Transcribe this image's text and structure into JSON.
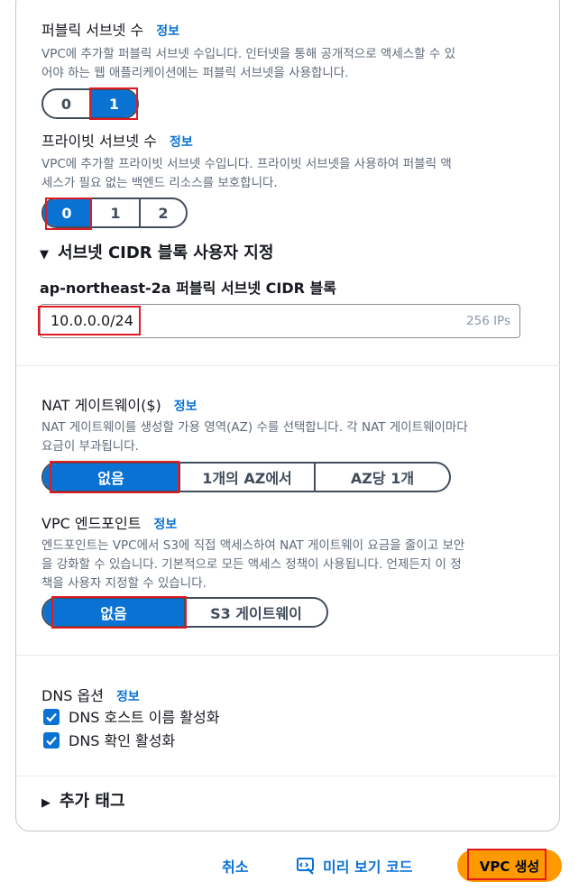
{
  "public_subnets": {
    "label": "퍼블릭 서브넷 수",
    "info": "정보",
    "desc_line1": "VPC에 추가할 퍼블릭 서브넷 수입니다. 인터넷을 통해 공개적으로 액세스할 수 있",
    "desc_line2": "어야 하는 웹 애플리케이션에는 퍼블릭 서브넷을 사용합니다.",
    "options": [
      "0",
      "1"
    ],
    "selected": "1"
  },
  "private_subnets": {
    "label": "프라이빗 서브넷 수",
    "info": "정보",
    "desc_line1": "VPC에 추가할 프라이빗 서브넷 수입니다. 프라이빗 서브넷을 사용하여 퍼블릭 액",
    "desc_line2": "세스가 필요 없는 백엔드 리소스를 보호합니다.",
    "options": [
      "0",
      "1",
      "2"
    ],
    "selected": "0"
  },
  "cidr_section": {
    "toggle_label": "서브넷 CIDR 블록 사용자 지정",
    "field_label": "ap-northeast-2a 퍼블릭 서브넷 CIDR 블록",
    "value": "10.0.0.0/24",
    "suffix": "256 IPs"
  },
  "nat": {
    "label": "NAT 게이트웨이($)",
    "info": "정보",
    "desc_line1": "NAT 게이트웨이를 생성할 가용 영역(AZ) 수를 선택합니다. 각 NAT 게이트웨이마다",
    "desc_line2": "요금이 부과됩니다.",
    "options": [
      "없음",
      "1개의 AZ에서",
      "AZ당 1개"
    ],
    "selected": "없음"
  },
  "endpoint": {
    "label": "VPC 엔드포인트",
    "info": "정보",
    "desc_line1": "엔드포인트는 VPC에서 S3에 직접 액세스하여 NAT 게이트웨이 요금을 줄이고 보안",
    "desc_line2": "을 강화할 수 있습니다. 기본적으로 모든 액세스 정책이 사용됩니다. 언제든지 이 정",
    "desc_line3": "책을 사용자 지정할 수 있습니다.",
    "options": [
      "없음",
      "S3 게이트웨이"
    ],
    "selected": "없음"
  },
  "dns": {
    "label": "DNS 옵션",
    "info": "정보",
    "hostnames": "DNS 호스트 이름 활성화",
    "resolution": "DNS 확인 활성화",
    "hostnames_checked": true,
    "resolution_checked": true
  },
  "tags": {
    "toggle_label": "추가 태그"
  },
  "footer": {
    "cancel": "취소",
    "preview": "미리 보기 코드",
    "create": "VPC 생성"
  },
  "colors": {
    "accent": "#0972d3",
    "primary": "#ff9900",
    "highlight": "#e01b24"
  },
  "icons": [
    "caret-down-icon",
    "caret-right-icon",
    "checkbox-checked-icon",
    "preview-code-icon"
  ]
}
